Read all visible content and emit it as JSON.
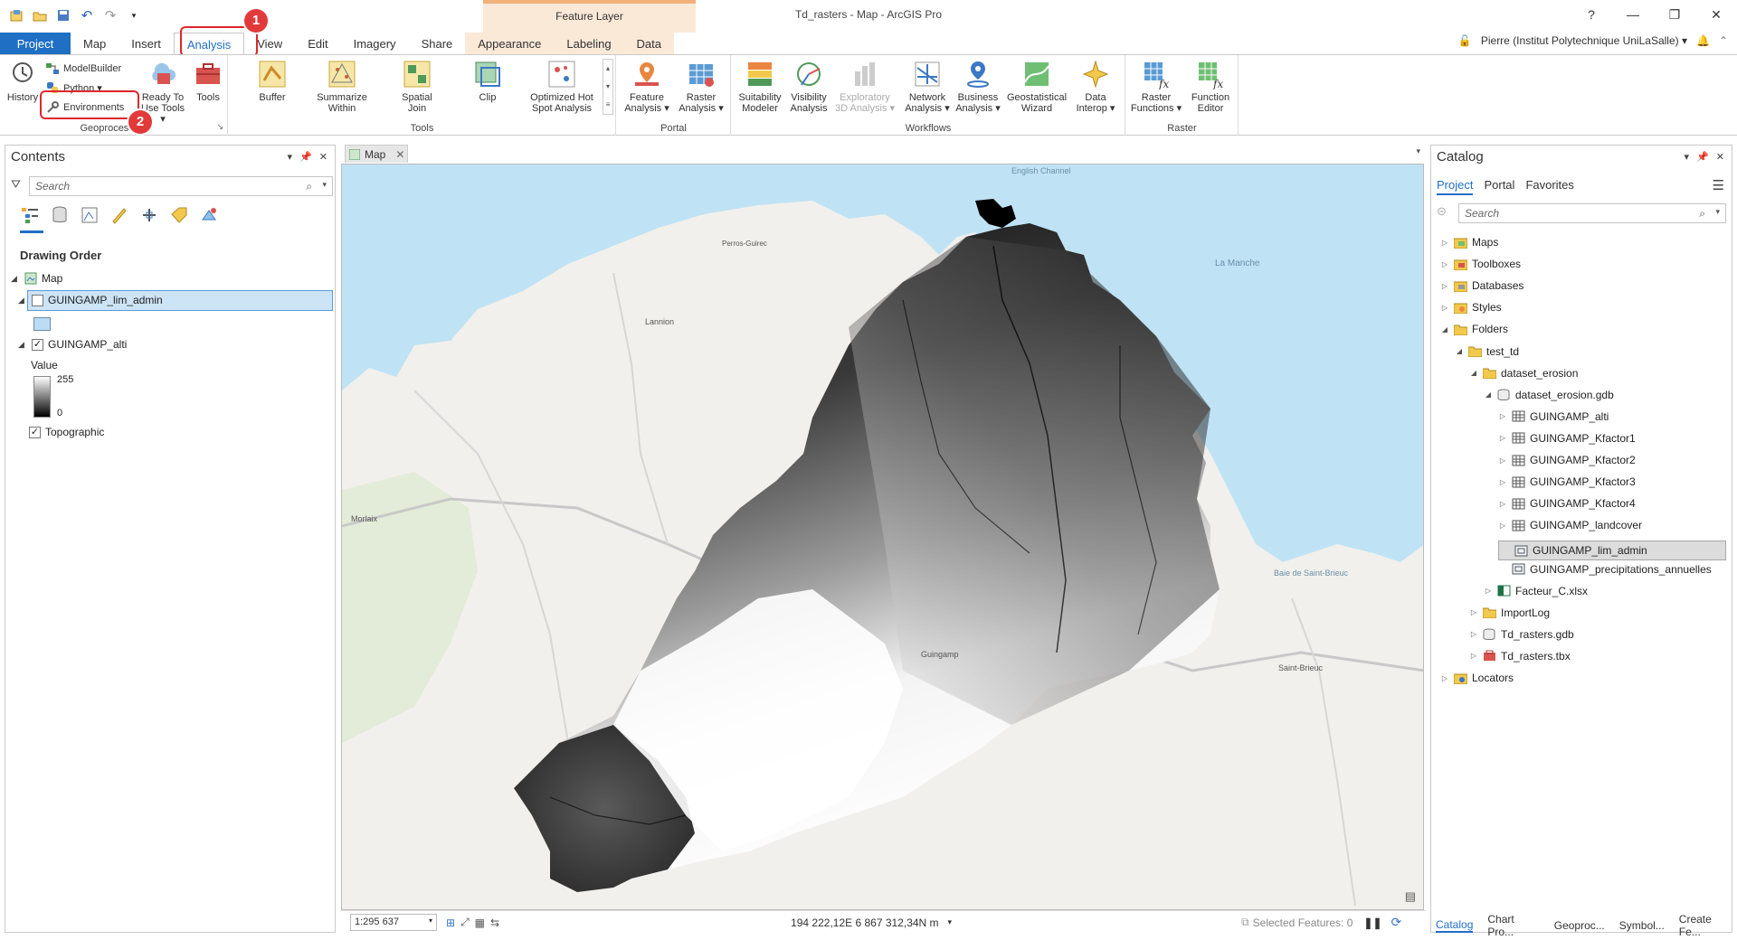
{
  "window": {
    "title": "Td_rasters - Map - ArcGIS Pro",
    "context_tab_header": "Feature Layer",
    "controls": [
      "?",
      "—",
      "❐",
      "✕"
    ]
  },
  "tabs": [
    "Project",
    "Map",
    "Insert",
    "Analysis",
    "View",
    "Edit",
    "Imagery",
    "Share",
    "Appearance",
    "Labeling",
    "Data"
  ],
  "active_tab": "Analysis",
  "user": {
    "name": "Pierre (Institut Polytechnique UniLaSalle) ▾"
  },
  "annotations": {
    "badge1": "1",
    "badge2": "2"
  },
  "ribbon": {
    "geoprocessing": {
      "label": "Geoprocessing",
      "history": "History",
      "modelbuilder": "ModelBuilder",
      "python": "Python ▾",
      "environments": "Environments",
      "ready_to_use_1": "Ready To",
      "ready_to_use_2": "Use Tools ▾",
      "tools": "Tools"
    },
    "tools": {
      "label": "Tools",
      "buttons": [
        {
          "l1": "Buffer",
          "l2": ""
        },
        {
          "l1": "Summarize",
          "l2": "Within"
        },
        {
          "l1": "Spatial",
          "l2": "Join"
        },
        {
          "l1": "Clip",
          "l2": ""
        },
        {
          "l1": "Optimized Hot",
          "l2": "Spot Analysis"
        }
      ]
    },
    "portal": {
      "label": "Portal",
      "buttons": [
        {
          "l1": "Feature",
          "l2": "Analysis ▾"
        },
        {
          "l1": "Raster",
          "l2": "Analysis ▾"
        }
      ]
    },
    "workflows": {
      "label": "Workflows",
      "buttons": [
        {
          "l1": "Suitability",
          "l2": "Modeler"
        },
        {
          "l1": "Visibility",
          "l2": "Analysis"
        },
        {
          "l1": "Exploratory",
          "l2": "3D Analysis ▾"
        },
        {
          "l1": "Network",
          "l2": "Analysis ▾"
        },
        {
          "l1": "Business",
          "l2": "Analysis ▾"
        },
        {
          "l1": "Geostatistical",
          "l2": "Wizard"
        },
        {
          "l1": "Data",
          "l2": "Interop ▾"
        }
      ]
    },
    "raster": {
      "label": "Raster",
      "buttons": [
        {
          "l1": "Raster",
          "l2": "Functions ▾"
        },
        {
          "l1": "Function",
          "l2": "Editor"
        }
      ]
    }
  },
  "contents": {
    "title": "Contents",
    "search_placeholder": "Search",
    "drawing_order": "Drawing Order",
    "map_name": "Map",
    "layers": {
      "lim_admin": "GUINGAMP_lim_admin",
      "alti": "GUINGAMP_alti",
      "value_label": "Value",
      "value_max": "255",
      "value_min": "0",
      "topographic": "Topographic"
    }
  },
  "mapview": {
    "tab_label": "Map",
    "scale": "1:295 637",
    "coordinates": "194 222,12E 6 867 312,34N m",
    "selected_features": "Selected Features: 0",
    "place_labels": {
      "channel": "English Channel",
      "manche": "La Manche",
      "baie": "Baie de Saint-Brieuc",
      "stbrieuc": "Saint-Brieuc",
      "lannion": "Lannion",
      "perros": "Perros-Guirec",
      "guingamp": "Guingamp",
      "morlaix": "Morlaix"
    }
  },
  "catalog": {
    "title": "Catalog",
    "tabs": [
      "Project",
      "Portal",
      "Favorites"
    ],
    "search_placeholder": "Search",
    "items": [
      {
        "label": "Maps",
        "indent": 0,
        "exp": "▷",
        "icon": "map-folder"
      },
      {
        "label": "Toolboxes",
        "indent": 0,
        "exp": "▷",
        "icon": "toolbox-folder"
      },
      {
        "label": "Databases",
        "indent": 0,
        "exp": "▷",
        "icon": "database-folder"
      },
      {
        "label": "Styles",
        "indent": 0,
        "exp": "▷",
        "icon": "style-folder"
      },
      {
        "label": "Folders",
        "indent": 0,
        "exp": "◢",
        "icon": "folder"
      },
      {
        "label": "test_td",
        "indent": 1,
        "exp": "◢",
        "icon": "folder"
      },
      {
        "label": "dataset_erosion",
        "indent": 2,
        "exp": "◢",
        "icon": "folder"
      },
      {
        "label": "dataset_erosion.gdb",
        "indent": 3,
        "exp": "◢",
        "icon": "gdb"
      },
      {
        "label": "GUINGAMP_alti",
        "indent": 4,
        "exp": "▷",
        "icon": "raster"
      },
      {
        "label": "GUINGAMP_Kfactor1",
        "indent": 4,
        "exp": "▷",
        "icon": "raster"
      },
      {
        "label": "GUINGAMP_Kfactor2",
        "indent": 4,
        "exp": "▷",
        "icon": "raster"
      },
      {
        "label": "GUINGAMP_Kfactor3",
        "indent": 4,
        "exp": "▷",
        "icon": "raster"
      },
      {
        "label": "GUINGAMP_Kfactor4",
        "indent": 4,
        "exp": "▷",
        "icon": "raster"
      },
      {
        "label": "GUINGAMP_landcover",
        "indent": 4,
        "exp": "▷",
        "icon": "raster"
      },
      {
        "label": "GUINGAMP_lim_admin",
        "indent": 4,
        "exp": "",
        "icon": "polygon",
        "selected": true
      },
      {
        "label": "GUINGAMP_precipitations_annuelles",
        "indent": 4,
        "exp": "",
        "icon": "polygon"
      },
      {
        "label": "Facteur_C.xlsx",
        "indent": 3,
        "exp": "▷",
        "icon": "excel"
      },
      {
        "label": "ImportLog",
        "indent": 2,
        "exp": "▷",
        "icon": "folder"
      },
      {
        "label": "Td_rasters.gdb",
        "indent": 2,
        "exp": "▷",
        "icon": "gdb"
      },
      {
        "label": "Td_rasters.tbx",
        "indent": 2,
        "exp": "▷",
        "icon": "toolbox"
      },
      {
        "label": "Locators",
        "indent": 0,
        "exp": "▷",
        "icon": "locator-folder"
      }
    ]
  },
  "bottom_tabs": [
    "Catalog",
    "Chart Pro...",
    "Geoproc...",
    "Symbol...",
    "Create Fe..."
  ],
  "colors": {
    "accent": "#1f6fc5",
    "annotation": "#e0262b",
    "water": "#bfe3f5",
    "land": "#f2f0ec"
  }
}
